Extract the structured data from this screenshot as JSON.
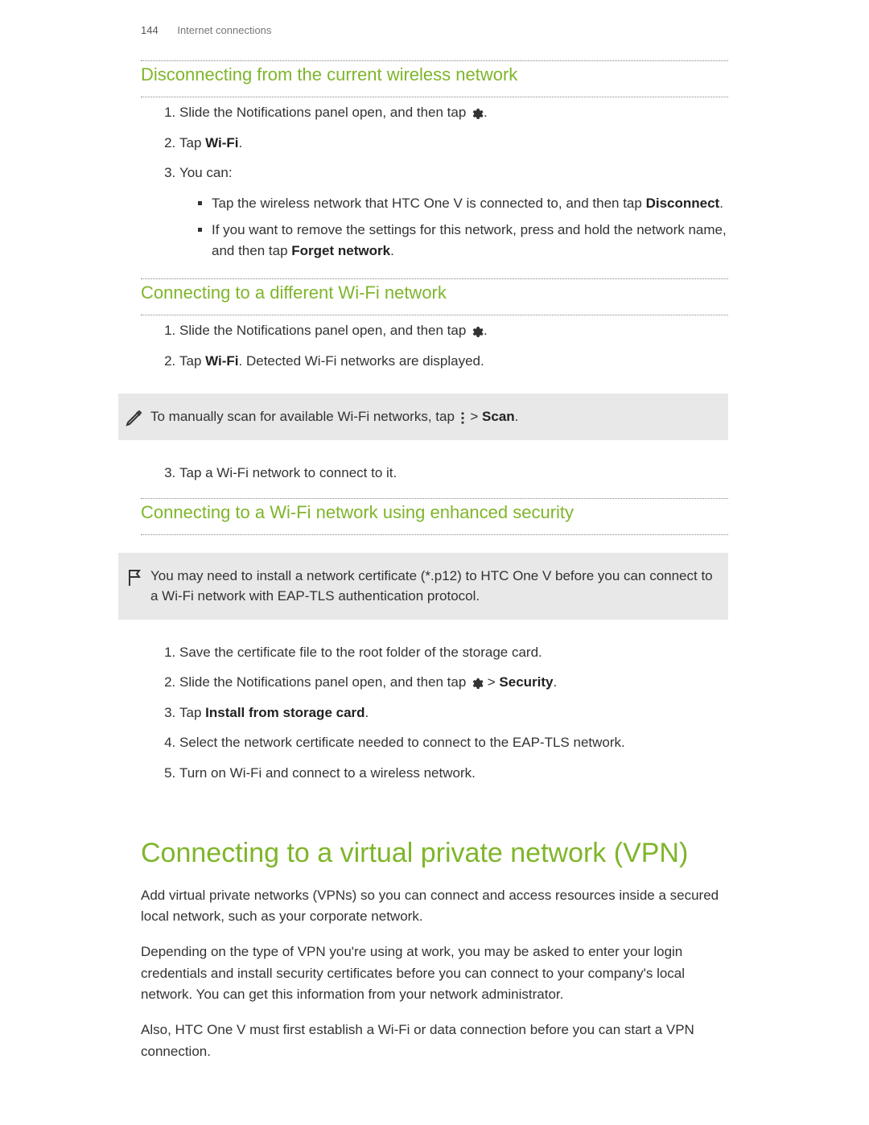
{
  "page_number": "144",
  "chapter": "Internet connections",
  "sec1": {
    "title": "Disconnecting from the current wireless network",
    "step1_a": "Slide the Notifications panel open, and then tap ",
    "step1_b": ".",
    "step2_a": "Tap ",
    "step2_bold": "Wi-Fi",
    "step2_b": ".",
    "step3": "You can:",
    "bullet1_a": "Tap the wireless network that HTC One V is connected to, and then tap ",
    "bullet1_bold": "Disconnect",
    "bullet1_b": ".",
    "bullet2_a": "If you want to remove the settings for this network, press and hold the network name, and then tap ",
    "bullet2_bold": "Forget network",
    "bullet2_b": "."
  },
  "sec2": {
    "title": "Connecting to a different Wi-Fi network",
    "step1_a": "Slide the Notifications panel open, and then tap ",
    "step1_b": ".",
    "step2_a": "Tap ",
    "step2_bold": "Wi-Fi",
    "step2_b": ". Detected Wi-Fi networks are displayed.",
    "callout_a": "To manually scan for available Wi-Fi networks, tap ",
    "callout_gt": " > ",
    "callout_bold": "Scan",
    "callout_b": ".",
    "step3": "Tap a Wi-Fi network to connect to it."
  },
  "sec3": {
    "title": "Connecting to a Wi-Fi network using enhanced security",
    "callout": "You may need to install a network certificate (*.p12) to HTC One V before you can connect to a Wi-Fi network with EAP-TLS authentication protocol.",
    "step1": "Save the certificate file to the root folder of the storage card.",
    "step2_a": "Slide the Notifications panel open, and then tap ",
    "step2_gt": " > ",
    "step2_bold": "Security",
    "step2_b": ".",
    "step3_a": "Tap ",
    "step3_bold": "Install from storage card",
    "step3_b": ".",
    "step4": "Select the network certificate needed to connect to the EAP-TLS network.",
    "step5": "Turn on Wi-Fi and connect to a wireless network."
  },
  "vpn": {
    "title": "Connecting to a virtual private network (VPN)",
    "p1": "Add virtual private networks (VPNs) so you can connect and access resources inside a secured local network, such as your corporate network.",
    "p2": "Depending on the type of VPN you're using at work, you may be asked to enter your login credentials and install security certificates before you can connect to your company's local network. You can get this information from your network administrator.",
    "p3": "Also, HTC One V must first establish a Wi-Fi or data connection before you can start a VPN connection."
  }
}
